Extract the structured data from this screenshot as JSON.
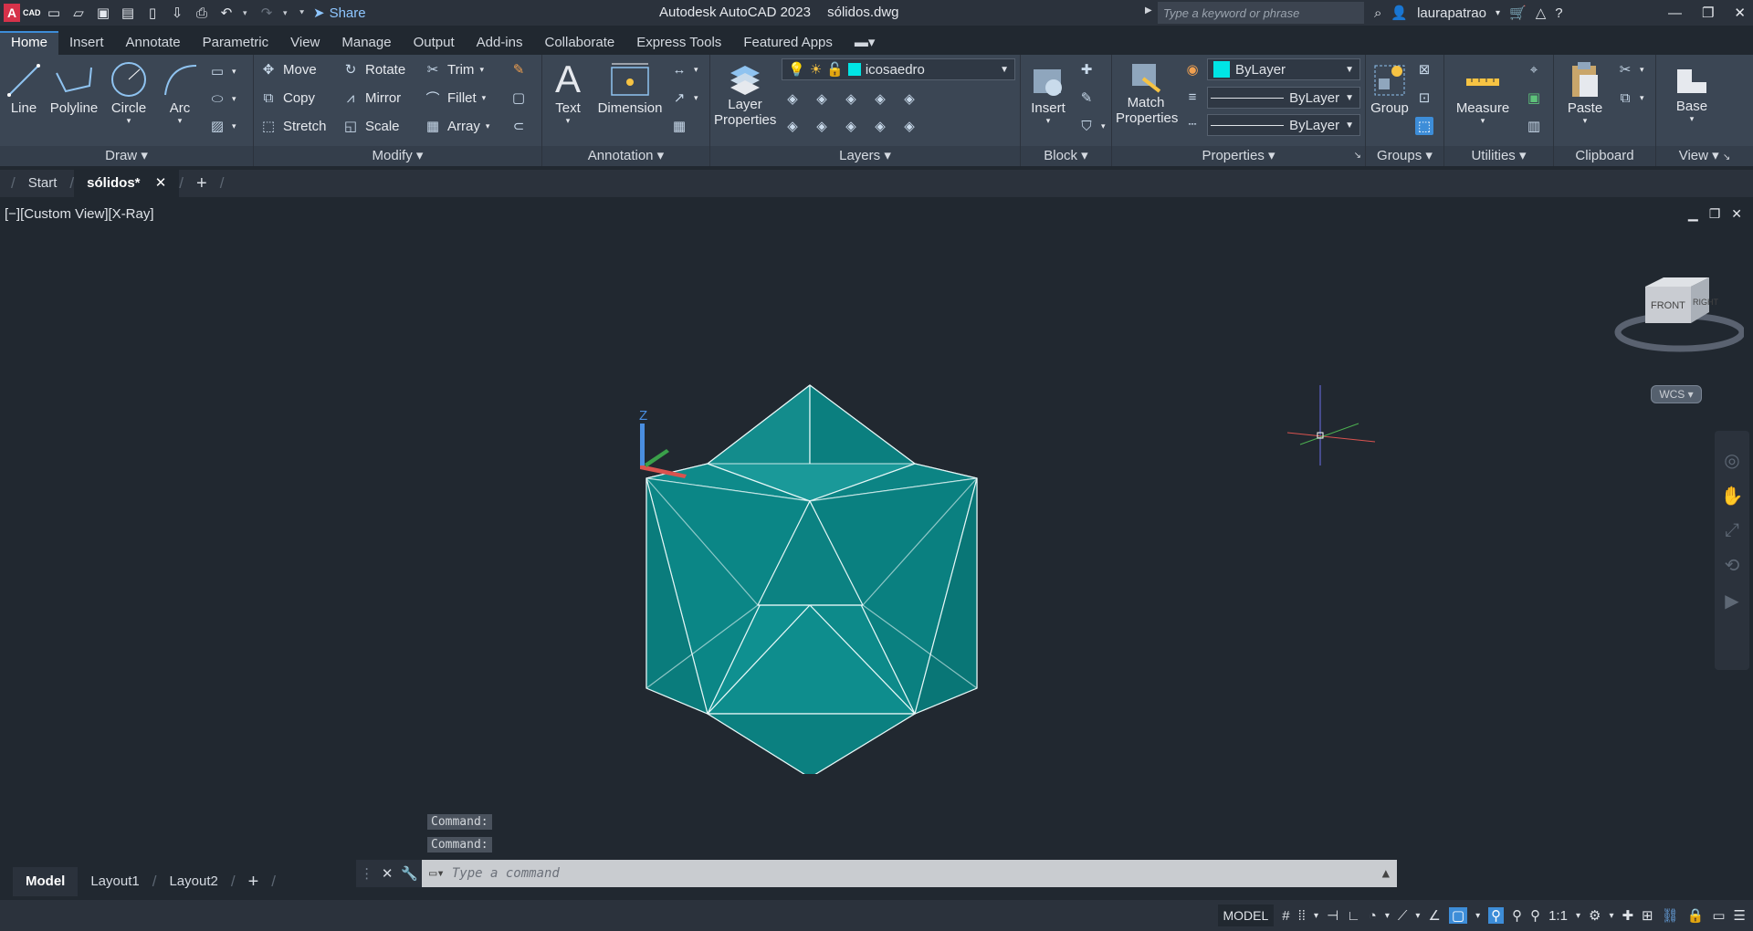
{
  "app": {
    "logo_letter": "A",
    "logo_sub": "CAD",
    "title": "Autodesk AutoCAD 2023",
    "filename": "sólidos.dwg",
    "share_label": "Share",
    "search_placeholder": "Type a keyword or phrase",
    "username": "laurapatrao"
  },
  "ribbon_tabs": [
    {
      "label": "Home",
      "active": true
    },
    {
      "label": "Insert"
    },
    {
      "label": "Annotate"
    },
    {
      "label": "Parametric"
    },
    {
      "label": "View"
    },
    {
      "label": "Manage"
    },
    {
      "label": "Output"
    },
    {
      "label": "Add-ins"
    },
    {
      "label": "Collaborate"
    },
    {
      "label": "Express Tools"
    },
    {
      "label": "Featured Apps"
    }
  ],
  "panels": {
    "draw": {
      "label": "Draw",
      "line": "Line",
      "polyline": "Polyline",
      "circle": "Circle",
      "arc": "Arc"
    },
    "modify": {
      "label": "Modify",
      "move": "Move",
      "rotate": "Rotate",
      "trim": "Trim",
      "copy": "Copy",
      "mirror": "Mirror",
      "fillet": "Fillet",
      "stretch": "Stretch",
      "scale": "Scale",
      "array": "Array"
    },
    "annotation": {
      "label": "Annotation",
      "text": "Text",
      "dimension": "Dimension"
    },
    "layers": {
      "label": "Layers",
      "layer_properties_1": "Layer",
      "layer_properties_2": "Properties",
      "current_layer": "icosaedro",
      "layer_color": "#00e5e5"
    },
    "block": {
      "label": "Block",
      "insert": "Insert"
    },
    "properties": {
      "label": "Properties",
      "match_1": "Match",
      "match_2": "Properties",
      "color": "ByLayer",
      "linetype": "ByLayer",
      "lineweight": "ByLayer"
    },
    "groups": {
      "label": "Groups",
      "group": "Group"
    },
    "utilities": {
      "label": "Utilities",
      "measure": "Measure"
    },
    "clipboard": {
      "label": "Clipboard",
      "paste": "Paste"
    },
    "view": {
      "label": "View",
      "base": "Base"
    }
  },
  "doc_tabs": {
    "start": "Start",
    "active": "sólidos*"
  },
  "viewport": {
    "label": "[−][Custom View][X-Ray]",
    "wcs": "WCS",
    "viewcube_front": "FRONT",
    "viewcube_right": "RIGHT",
    "ucs_z": "Z",
    "solid_color": "#0e8f8f"
  },
  "command": {
    "history": [
      "Command:",
      "Command:"
    ],
    "placeholder": "Type a command"
  },
  "layout_tabs": [
    "Model",
    "Layout1",
    "Layout2"
  ],
  "status": {
    "model": "MODEL",
    "scale": "1:1"
  }
}
